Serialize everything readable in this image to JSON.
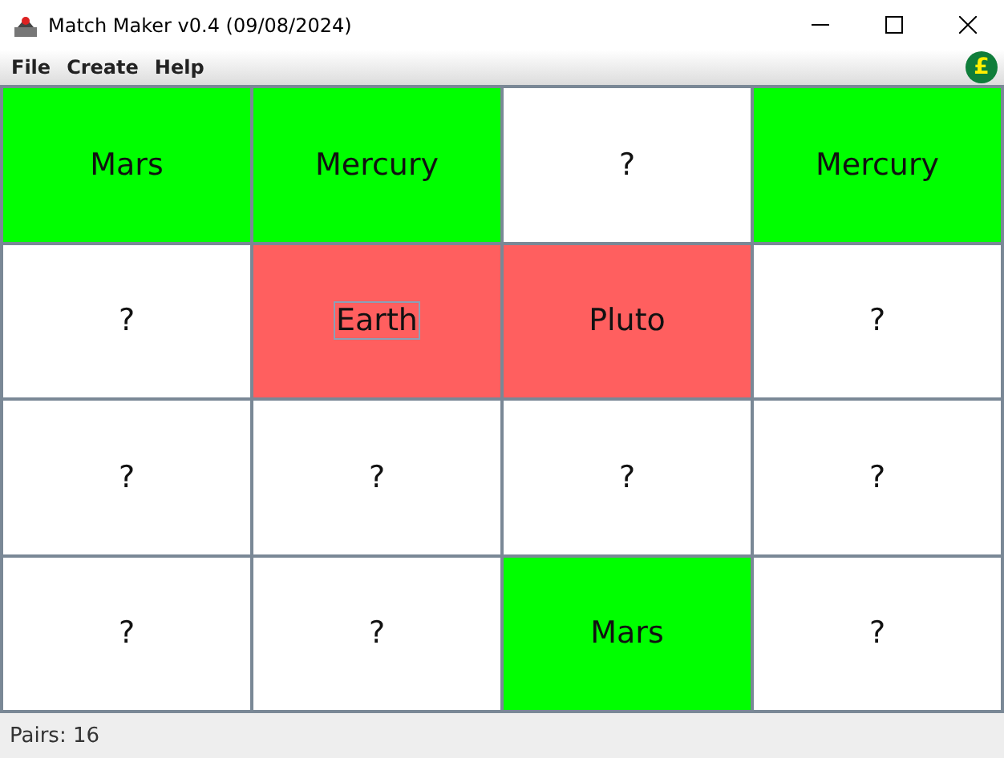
{
  "window": {
    "title": "Match Maker v0.4 (09/08/2024)"
  },
  "menu": [
    "File",
    "Create",
    "Help"
  ],
  "menu_badge": "£",
  "cards": [
    {
      "text": "Mars",
      "kind": "matched",
      "focused": false
    },
    {
      "text": "Mercury",
      "kind": "matched",
      "focused": false
    },
    {
      "text": "?",
      "kind": "hidden",
      "focused": false
    },
    {
      "text": "Mercury",
      "kind": "matched",
      "focused": false
    },
    {
      "text": "?",
      "kind": "hidden",
      "focused": false
    },
    {
      "text": "Earth",
      "kind": "wrong",
      "focused": true
    },
    {
      "text": "Pluto",
      "kind": "wrong",
      "focused": false
    },
    {
      "text": "?",
      "kind": "hidden",
      "focused": false
    },
    {
      "text": "?",
      "kind": "hidden",
      "focused": false
    },
    {
      "text": "?",
      "kind": "hidden",
      "focused": false
    },
    {
      "text": "?",
      "kind": "hidden",
      "focused": false
    },
    {
      "text": "?",
      "kind": "hidden",
      "focused": false
    },
    {
      "text": "?",
      "kind": "hidden",
      "focused": false
    },
    {
      "text": "?",
      "kind": "hidden",
      "focused": false
    },
    {
      "text": "Mars",
      "kind": "matched",
      "focused": false
    },
    {
      "text": "?",
      "kind": "hidden",
      "focused": false
    }
  ],
  "status_bar": "Pairs: 16"
}
